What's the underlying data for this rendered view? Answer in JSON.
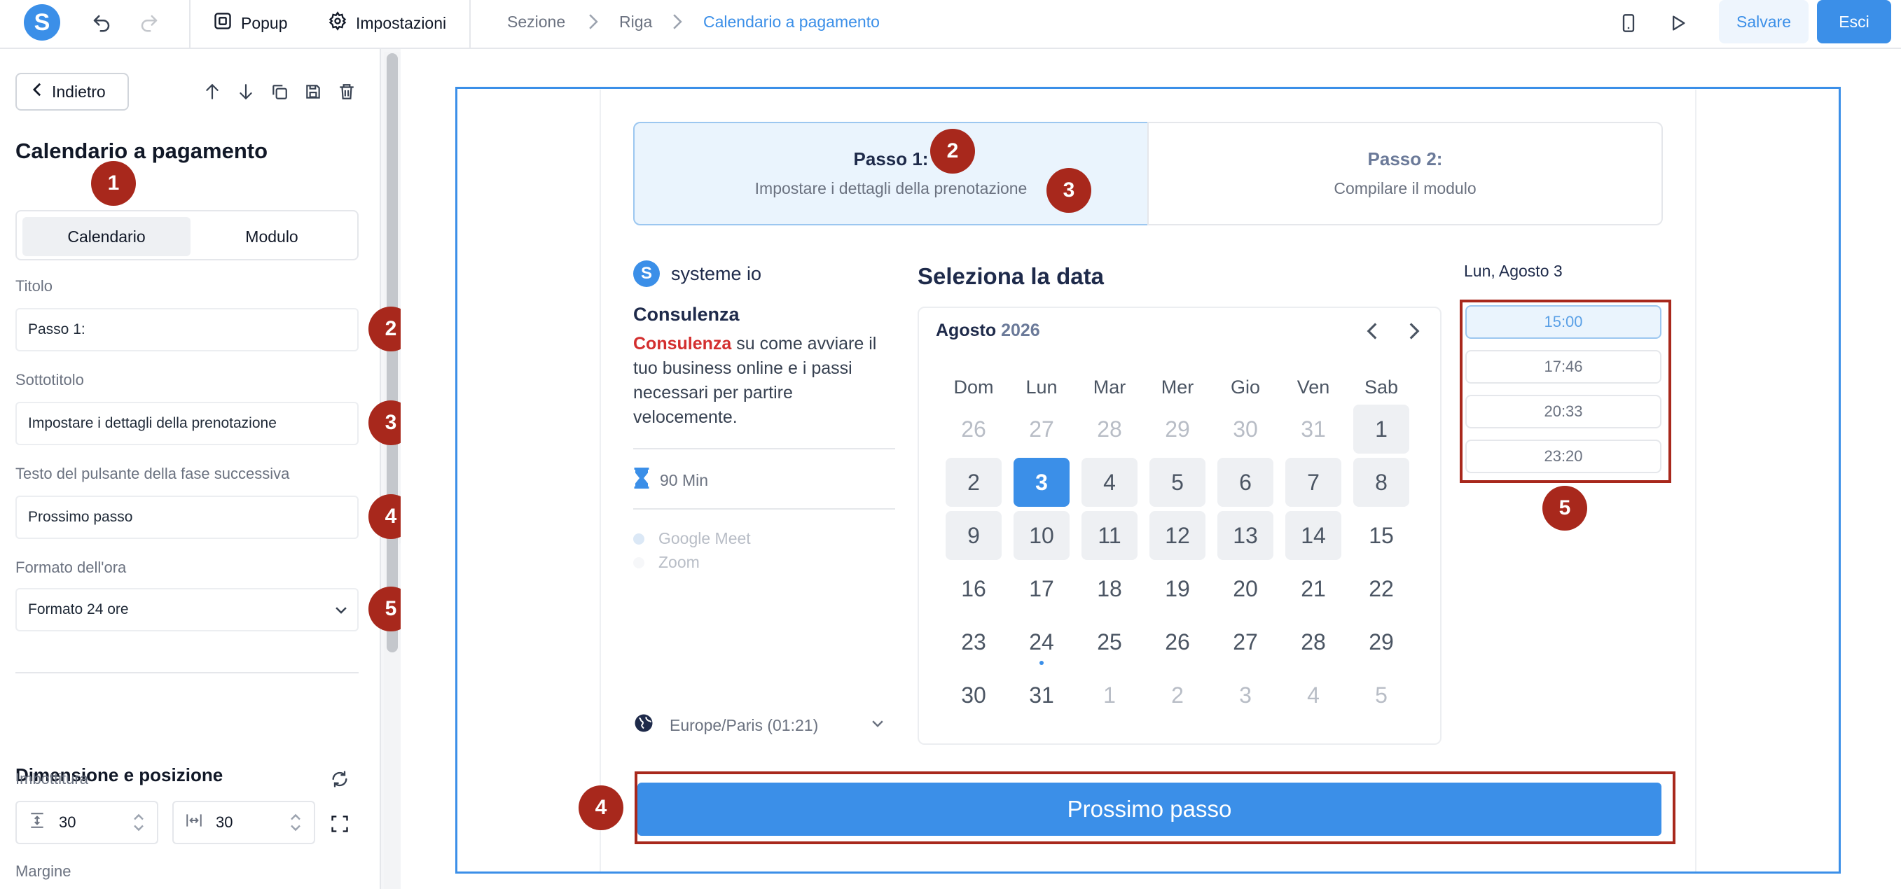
{
  "topbar": {
    "popup_label": "Popup",
    "settings_label": "Impostazioni",
    "breadcrumb": [
      "Sezione",
      "Riga",
      "Calendario a pagamento"
    ],
    "save_label": "Salvare",
    "exit_label": "Esci"
  },
  "panel": {
    "back_label": "Indietro",
    "title": "Calendario a pagamento",
    "tabs": [
      "Calendario",
      "Modulo"
    ],
    "fields": {
      "title_label": "Titolo",
      "title_value": "Passo 1:",
      "subtitle_label": "Sottotitolo",
      "subtitle_value": "Impostare i dettagli della prenotazione",
      "next_label": "Testo del pulsante della fase successiva",
      "next_value": "Prossimo passo",
      "time_format_label": "Formato dell'ora",
      "time_format_value": "Formato 24 ore"
    },
    "size_section": "Dimensione e posizione",
    "padding_label": "Imbottitura",
    "padding_vertical": "30",
    "padding_horizontal": "30",
    "margin_label": "Margine"
  },
  "badges": [
    "1",
    "2",
    "3",
    "4",
    "5"
  ],
  "steps": [
    {
      "title": "Passo 1:",
      "subtitle": "Impostare i dettagli della prenotazione"
    },
    {
      "title": "Passo 2:",
      "subtitle": "Compilare il modulo"
    }
  ],
  "event": {
    "brand": "systeme io",
    "title": "Consulenza",
    "desc_bold": "Consulenza",
    "desc_rest": " su come avviare il tuo business online e i passi necessari per partire velocemente.",
    "duration": "90 Min",
    "locations": [
      "Google Meet",
      "Zoom"
    ],
    "timezone": "Europe/Paris (01:21)"
  },
  "calendar": {
    "heading": "Seleziona la data",
    "month": "Agosto",
    "year": "2026",
    "weekdays": [
      "Dom",
      "Lun",
      "Mar",
      "Mer",
      "Gio",
      "Ven",
      "Sab"
    ],
    "weeks": [
      [
        "26",
        "27",
        "28",
        "29",
        "30",
        "31",
        "1"
      ],
      [
        "2",
        "3",
        "4",
        "5",
        "6",
        "7",
        "8"
      ],
      [
        "9",
        "10",
        "11",
        "12",
        "13",
        "14",
        "15"
      ],
      [
        "16",
        "17",
        "18",
        "19",
        "20",
        "21",
        "22"
      ],
      [
        "23",
        "24",
        "25",
        "26",
        "27",
        "28",
        "29"
      ],
      [
        "30",
        "31",
        "1",
        "2",
        "3",
        "4",
        "5"
      ]
    ],
    "selected_day": "3",
    "today_day": "24"
  },
  "slots": {
    "date": "Lun, Agosto 3",
    "times": [
      "15:00",
      "17:46",
      "20:33",
      "23:20"
    ],
    "selected": "15:00"
  },
  "next_button": "Prossimo passo",
  "colors": {
    "accent": "#3b8fe8",
    "annotation": "#a8281c",
    "highlight_red": "#d32f2f"
  }
}
